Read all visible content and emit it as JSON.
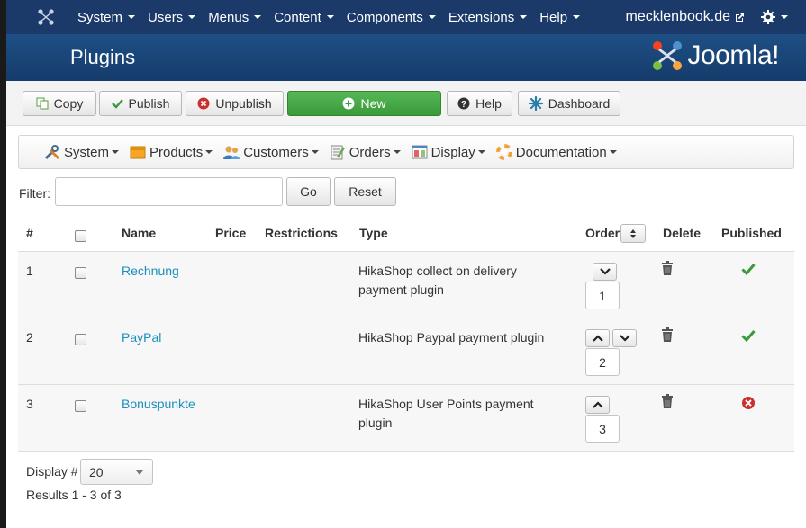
{
  "navbar": {
    "menus": [
      {
        "label": "System"
      },
      {
        "label": "Users"
      },
      {
        "label": "Menus"
      },
      {
        "label": "Content"
      },
      {
        "label": "Components"
      },
      {
        "label": "Extensions"
      },
      {
        "label": "Help"
      }
    ],
    "site_name": "mecklenbook.de",
    "settings_icon": "gear-icon"
  },
  "header": {
    "title": "Plugins",
    "brand": "Joomla!"
  },
  "toolbar": {
    "copy": "Copy",
    "publish": "Publish",
    "unpublish": "Unpublish",
    "new": "New",
    "help": "Help",
    "dashboard": "Dashboard"
  },
  "submenu": {
    "items": [
      {
        "label": "System",
        "icon": "tools-icon"
      },
      {
        "label": "Products",
        "icon": "box-icon"
      },
      {
        "label": "Customers",
        "icon": "users-icon"
      },
      {
        "label": "Orders",
        "icon": "order-icon"
      },
      {
        "label": "Display",
        "icon": "window-icon"
      },
      {
        "label": "Documentation",
        "icon": "help-icon"
      }
    ]
  },
  "filter": {
    "label": "Filter:",
    "value": "",
    "go": "Go",
    "reset": "Reset"
  },
  "table": {
    "columns": {
      "num": "#",
      "name": "Name",
      "price": "Price",
      "restrictions": "Restrictions",
      "type": "Type",
      "order": "Order",
      "delete": "Delete",
      "published": "Published"
    },
    "rows": [
      {
        "num": "1",
        "name": "Rechnung",
        "type": "HikaShop collect on delivery payment plugin",
        "order": "1",
        "published": true
      },
      {
        "num": "2",
        "name": "PayPal",
        "type": "HikaShop Paypal payment plugin",
        "order": "2",
        "published": true
      },
      {
        "num": "3",
        "name": "Bonuspunkte",
        "type": "HikaShop User Points payment plugin",
        "order": "3",
        "published": false
      }
    ]
  },
  "footer": {
    "display_label": "Display #",
    "display_value": "20",
    "results": "Results 1 - 3 of 3"
  },
  "colors": {
    "navbar": "#1b3a69",
    "header": "#1e4f85",
    "link": "#1a8fbd",
    "success": "#3b9a3b",
    "danger": "#c9302c"
  }
}
